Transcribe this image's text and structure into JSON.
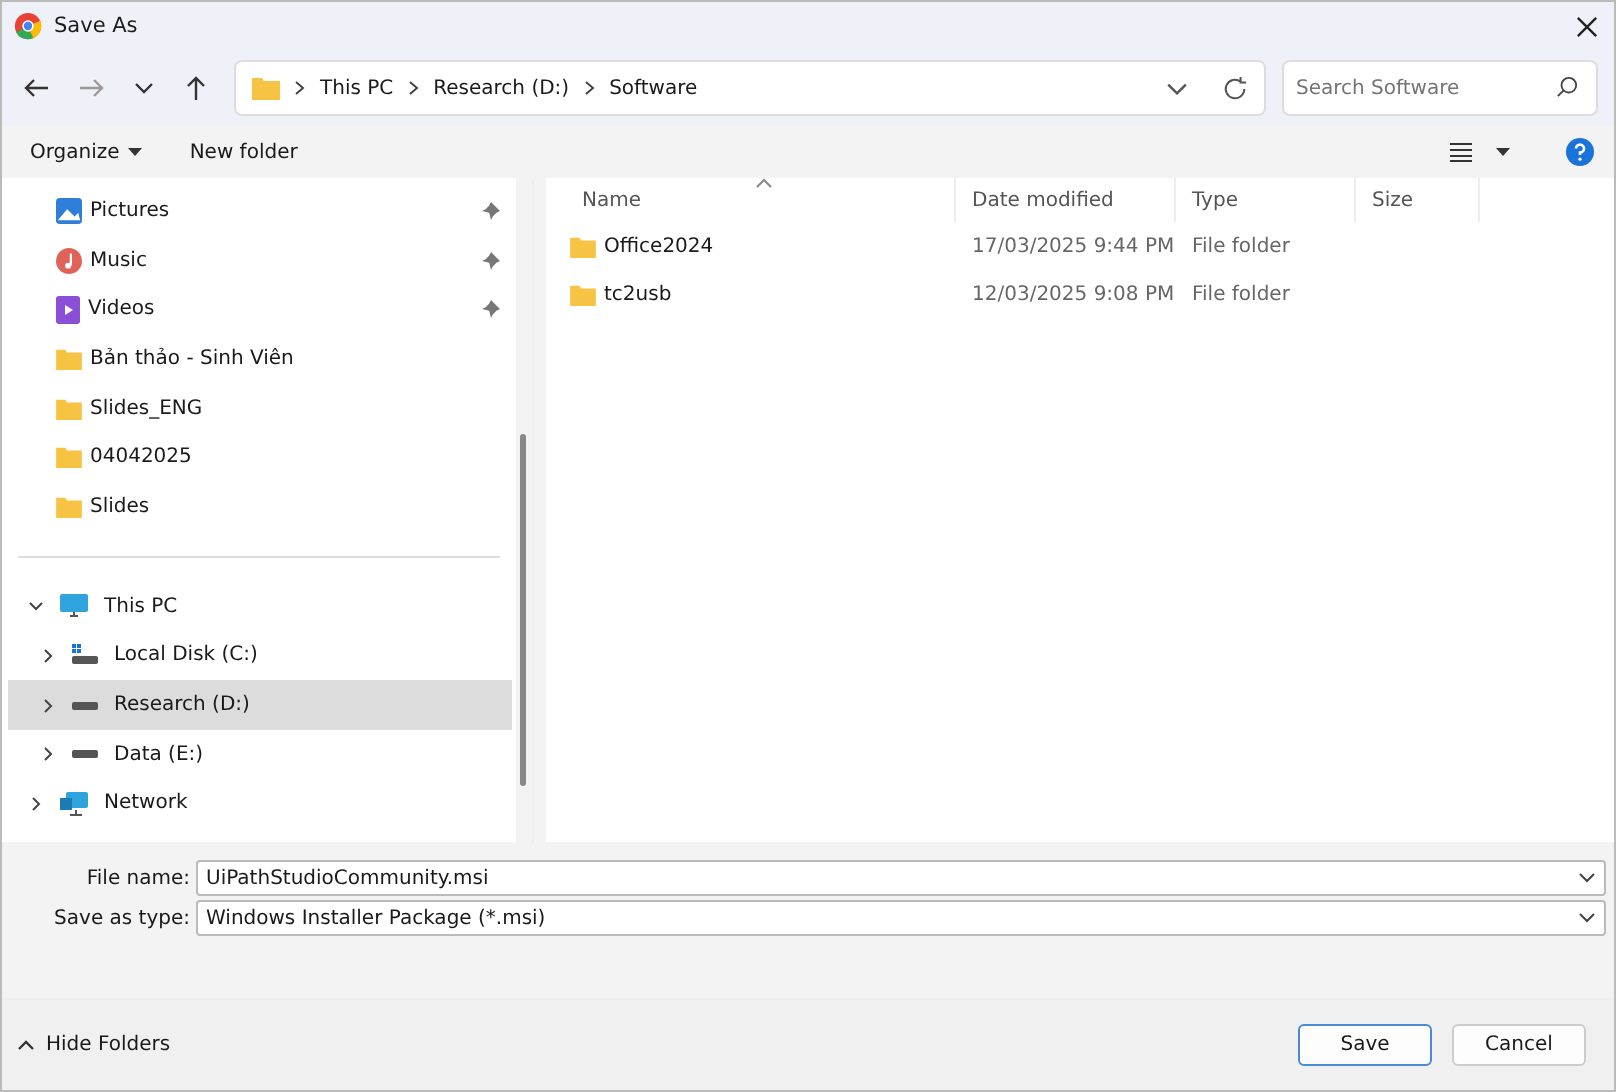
{
  "window": {
    "title": "Save As"
  },
  "address": {
    "crumbs": [
      "This PC",
      "Research (D:)",
      "Software"
    ],
    "search_placeholder": "Search Software"
  },
  "toolbar": {
    "organize": "Organize",
    "new_folder": "New folder"
  },
  "quick_access": [
    {
      "label": "Pictures",
      "kind": "pictures",
      "pinned": true
    },
    {
      "label": "Music",
      "kind": "music",
      "pinned": true
    },
    {
      "label": "Videos",
      "kind": "videos",
      "pinned": true
    },
    {
      "label": "Bản thảo - Sinh Viên",
      "kind": "folder",
      "pinned": false
    },
    {
      "label": "Slides_ENG",
      "kind": "folder",
      "pinned": false
    },
    {
      "label": "04042025",
      "kind": "folder",
      "pinned": false
    },
    {
      "label": "Slides",
      "kind": "folder",
      "pinned": false
    }
  ],
  "tree": [
    {
      "label": "This PC",
      "kind": "pc",
      "expanded": true,
      "selected": false,
      "children": [
        {
          "label": "Local Disk (C:)",
          "kind": "sysdrive",
          "expanded": false,
          "selected": false
        },
        {
          "label": "Research (D:)",
          "kind": "drive",
          "expanded": false,
          "selected": true
        },
        {
          "label": "Data (E:)",
          "kind": "drive",
          "expanded": false,
          "selected": false
        }
      ]
    },
    {
      "label": "Network",
      "kind": "network",
      "expanded": false,
      "selected": false
    }
  ],
  "table": {
    "columns": [
      "Name",
      "Date modified",
      "Type",
      "Size"
    ],
    "rows": [
      {
        "name": "Office2024",
        "date": "17/03/2025 9:44 PM",
        "type": "File folder"
      },
      {
        "name": "tc2usb",
        "date": "12/03/2025 9:08 PM",
        "type": "File folder"
      }
    ]
  },
  "form": {
    "file_name_label": "File name:",
    "file_name": "UiPathStudioCommunity.msi",
    "type_label": "Save as type:",
    "type": "Windows Installer Package (*.msi)"
  },
  "footer": {
    "hide_folders": "Hide Folders",
    "save": "Save",
    "cancel": "Cancel"
  }
}
